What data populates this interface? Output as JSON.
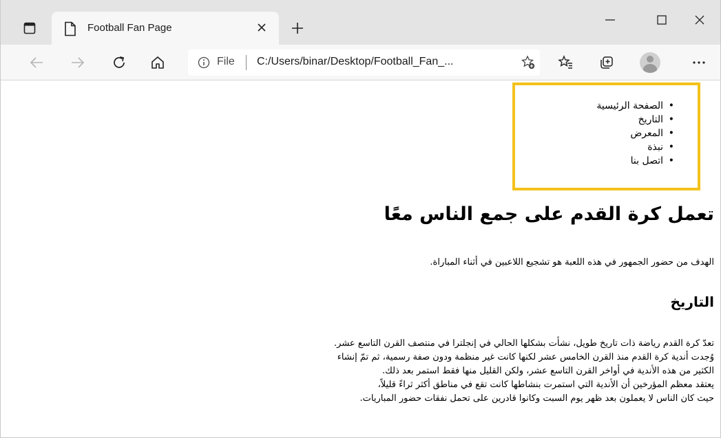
{
  "browser": {
    "tab_title": "Football Fan Page",
    "address_scheme": "File",
    "address_url": "C:/Users/binar/Desktop/Football_Fan_...",
    "icons": {
      "tab_actions": "tab-actions-icon",
      "page": "document-icon",
      "tab_close": "close-icon",
      "new_tab": "plus-icon",
      "minimize": "minimize-icon",
      "maximize": "maximize-icon",
      "window_close": "close-icon",
      "back": "back-arrow-icon",
      "forward": "forward-arrow-icon",
      "refresh": "refresh-icon",
      "home": "home-icon",
      "info": "info-icon",
      "add_favorite": "add-favorite-icon",
      "favorites": "favorites-icon",
      "collections": "collections-icon",
      "profile": "profile-avatar",
      "more": "more-icon"
    }
  },
  "page": {
    "nav_items": [
      "الصفحة الرئيسية",
      "التاريخ",
      "المعرض",
      "نبذة",
      "اتصل بنا"
    ],
    "nav_highlight_color": "#f3c21c",
    "heading": "تعمل كرة القدم على جمع الناس معًا",
    "intro": "الهدف من حضور الجمهور في هذه اللعبة هو تشجيع اللاعبين في أثناء المباراة.",
    "history_heading": "التاريخ",
    "history_lines": [
      "تعدّ كرة القدم رياضة ذات تاريخ طويل، نشأت بشكلها الحالي في إنجلترا في منتصف القرن التاسع عشر.",
      "وُجدت أندية كرة القدم منذ القرن الخامس عشر لكنها كانت غير منظمة ودون صفة رسمية، ثم تمّ إنشاء",
      "الكثير من هذه الأندية في أواخر القرن التاسع عشر، ولكن القليل منها فقط استمر بعد ذلك.",
      "يعتقد معظم المؤرخين أن الأندية التي استمرت بنشاطها كانت تقع في مناطق أكثر ثراءً قليلاً،",
      "حيث كان الناس لا يعملون بعد ظهر يوم السبت وكانوا قادرين على تحمل نفقات حضور المباريات."
    ]
  }
}
